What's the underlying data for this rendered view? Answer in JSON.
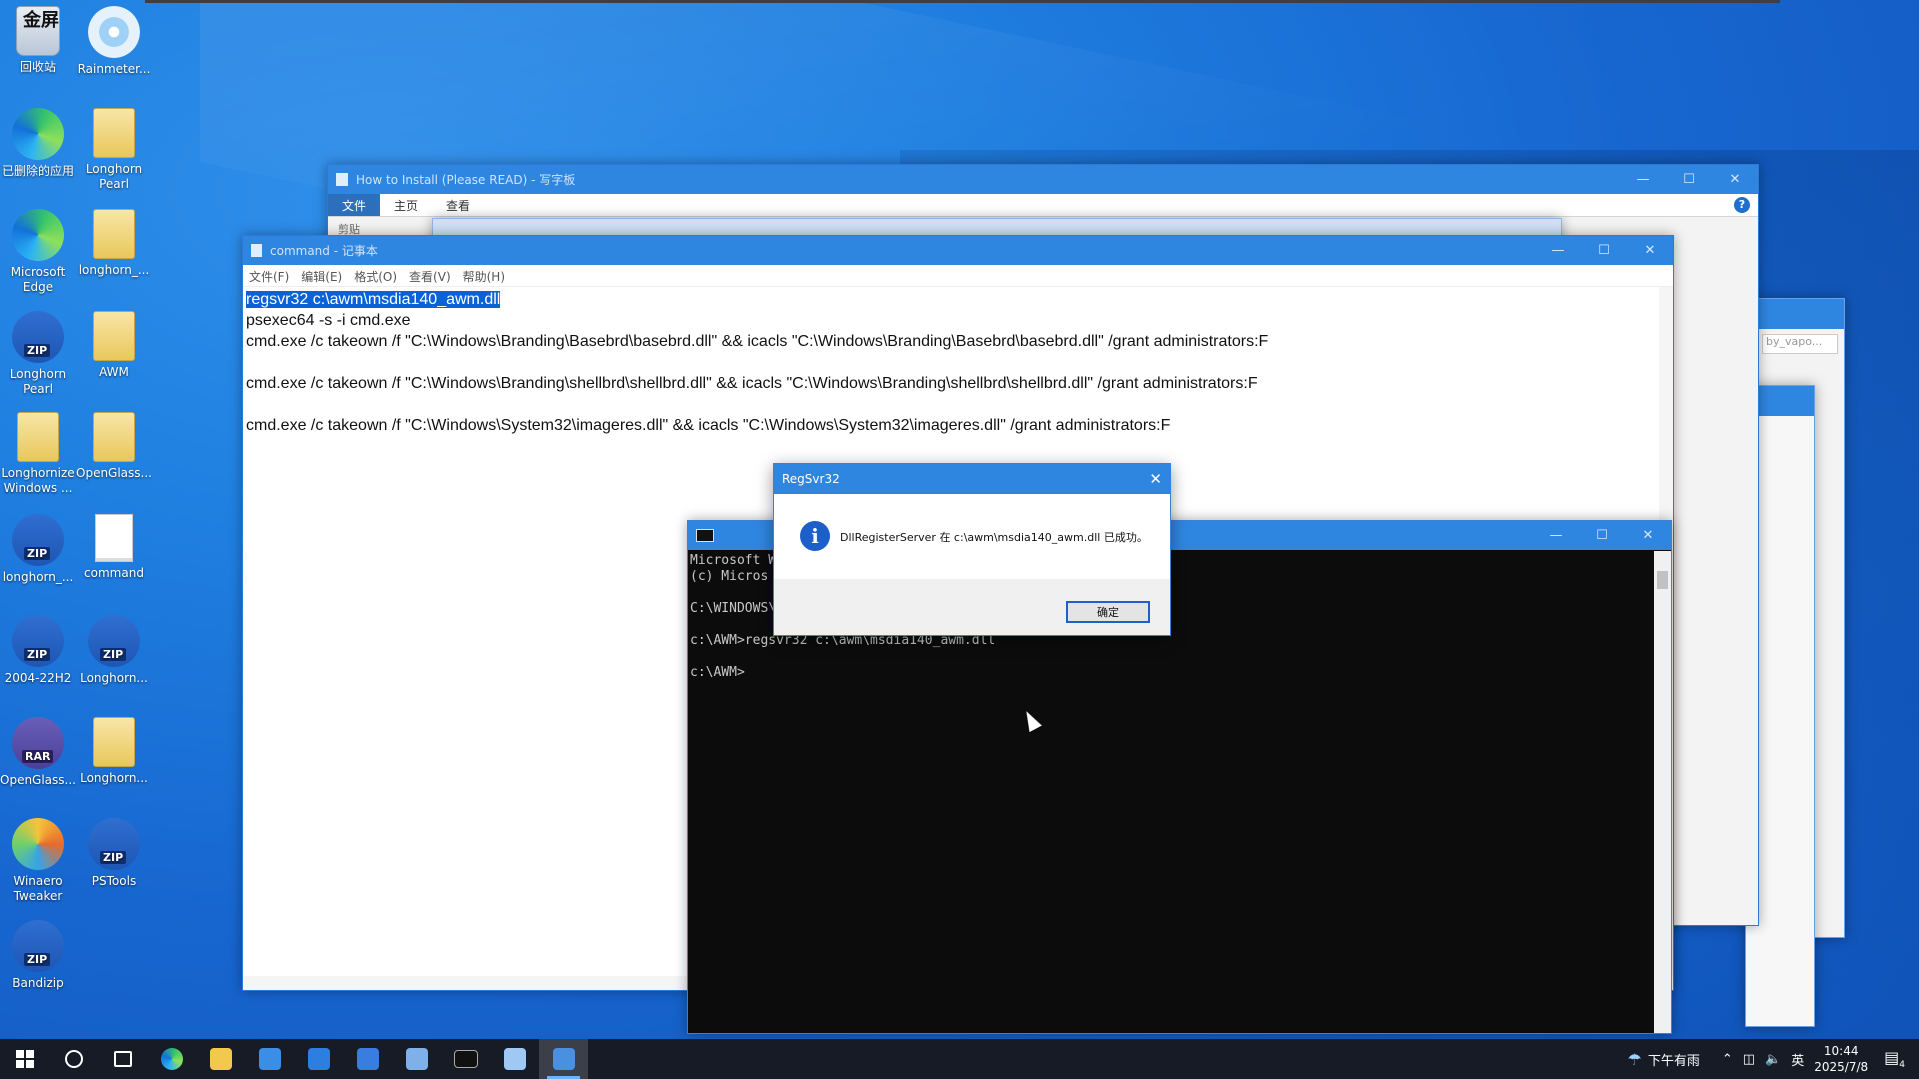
{
  "desktop": {
    "icons": [
      {
        "label": "回收站",
        "icon": "recycle-bin-icon",
        "overlay": "金屏"
      },
      {
        "label": "Rainmeter...",
        "icon": "rainmeter-icon"
      },
      {
        "label": "已删除的应用",
        "icon": "edge-icon"
      },
      {
        "label": "Longhorn Pearl",
        "icon": "folder-icon"
      },
      {
        "label": "Microsoft Edge",
        "icon": "edge-icon"
      },
      {
        "label": "longhorn_...",
        "icon": "folder-icon"
      },
      {
        "label": "Longhorn Pearl",
        "icon": "zip-icon"
      },
      {
        "label": "AWM",
        "icon": "folder-icon"
      },
      {
        "label": "Longhornize Windows ...",
        "icon": "folder-icon"
      },
      {
        "label": "OpenGlass...",
        "icon": "folder-icon"
      },
      {
        "label": "longhorn_...",
        "icon": "zip-icon"
      },
      {
        "label": "command",
        "icon": "text-file-icon"
      },
      {
        "label": "2004-22H2",
        "icon": "zip-icon"
      },
      {
        "label": "Longhorn...",
        "icon": "zip-icon"
      },
      {
        "label": "OpenGlass...",
        "icon": "rar-icon"
      },
      {
        "label": "Longhorn...",
        "icon": "folder-icon"
      },
      {
        "label": "Winaero Tweaker",
        "icon": "winaero-icon"
      },
      {
        "label": "PSTools",
        "icon": "zip-icon"
      },
      {
        "label": "Bandizip",
        "icon": "bandizip-icon"
      }
    ]
  },
  "wordpad": {
    "title": "How to Install (Please READ) - 写字板",
    "tabs": [
      "文件",
      "主页",
      "查看"
    ],
    "sub_label": "剪贴",
    "help": "?"
  },
  "explorer": {
    "search_placeholder": "by_vapo..."
  },
  "notepad": {
    "title": "command - 记事本",
    "menu": [
      "文件(F)",
      "编辑(E)",
      "格式(O)",
      "查看(V)",
      "帮助(H)"
    ],
    "lines": [
      "regsvr32 c:\\awm\\msdia140_awm.dll",
      "psexec64 -s -i cmd.exe",
      "cmd.exe /c takeown /f \"C:\\Windows\\Branding\\Basebrd\\basebrd.dll\" && icacls \"C:\\Windows\\Branding\\Basebrd\\basebrd.dll\" /grant administrators:F",
      "",
      "cmd.exe /c takeown /f \"C:\\Windows\\Branding\\shellbrd\\shellbrd.dll\" && icacls \"C:\\Windows\\Branding\\shellbrd\\shellbrd.dll\" /grant administrators:F",
      "",
      "cmd.exe /c takeown /f \"C:\\Windows\\System32\\imageres.dll\" && icacls \"C:\\Windows\\System32\\imageres.dll\" /grant administrators:F"
    ]
  },
  "cmd": {
    "lines": [
      "Microsoft W",
      "(c) Micros",
      "",
      "C:\\WINDOWS\\",
      "",
      "c:\\AWM>regsvr32 c:\\awm\\msdia140_awm.dll",
      "",
      "c:\\AWM>"
    ]
  },
  "dialog": {
    "title": "RegSvr32",
    "message": "DllRegisterServer 在 c:\\awm\\msdia140_awm.dll 已成功。",
    "ok_label": "确定",
    "info_glyph": "i"
  },
  "taskbar": {
    "apps": [
      {
        "name": "start",
        "icon": "windows-logo-icon"
      },
      {
        "name": "search",
        "icon": "search-icon"
      },
      {
        "name": "task-view",
        "icon": "task-view-icon"
      },
      {
        "name": "edge",
        "icon": "edge-icon"
      },
      {
        "name": "file-explorer",
        "icon": "folder-icon"
      },
      {
        "name": "store",
        "icon": "store-icon"
      },
      {
        "name": "mail",
        "icon": "mail-icon"
      },
      {
        "name": "bandizip",
        "icon": "bandizip-icon"
      },
      {
        "name": "regedit",
        "icon": "regedit-icon"
      },
      {
        "name": "terminal",
        "icon": "terminal-icon"
      },
      {
        "name": "notepad",
        "icon": "notepad-icon"
      },
      {
        "name": "wordpad",
        "icon": "wordpad-icon"
      }
    ],
    "weather": "下午有雨",
    "ime": "英",
    "time": "10:44",
    "date": "2025/7/8",
    "notifications": "4"
  },
  "colors": {
    "accent": "#2f86e1",
    "selection": "#0b62d6",
    "taskbar": "#161b26",
    "desktop": "#1f7fe0"
  }
}
